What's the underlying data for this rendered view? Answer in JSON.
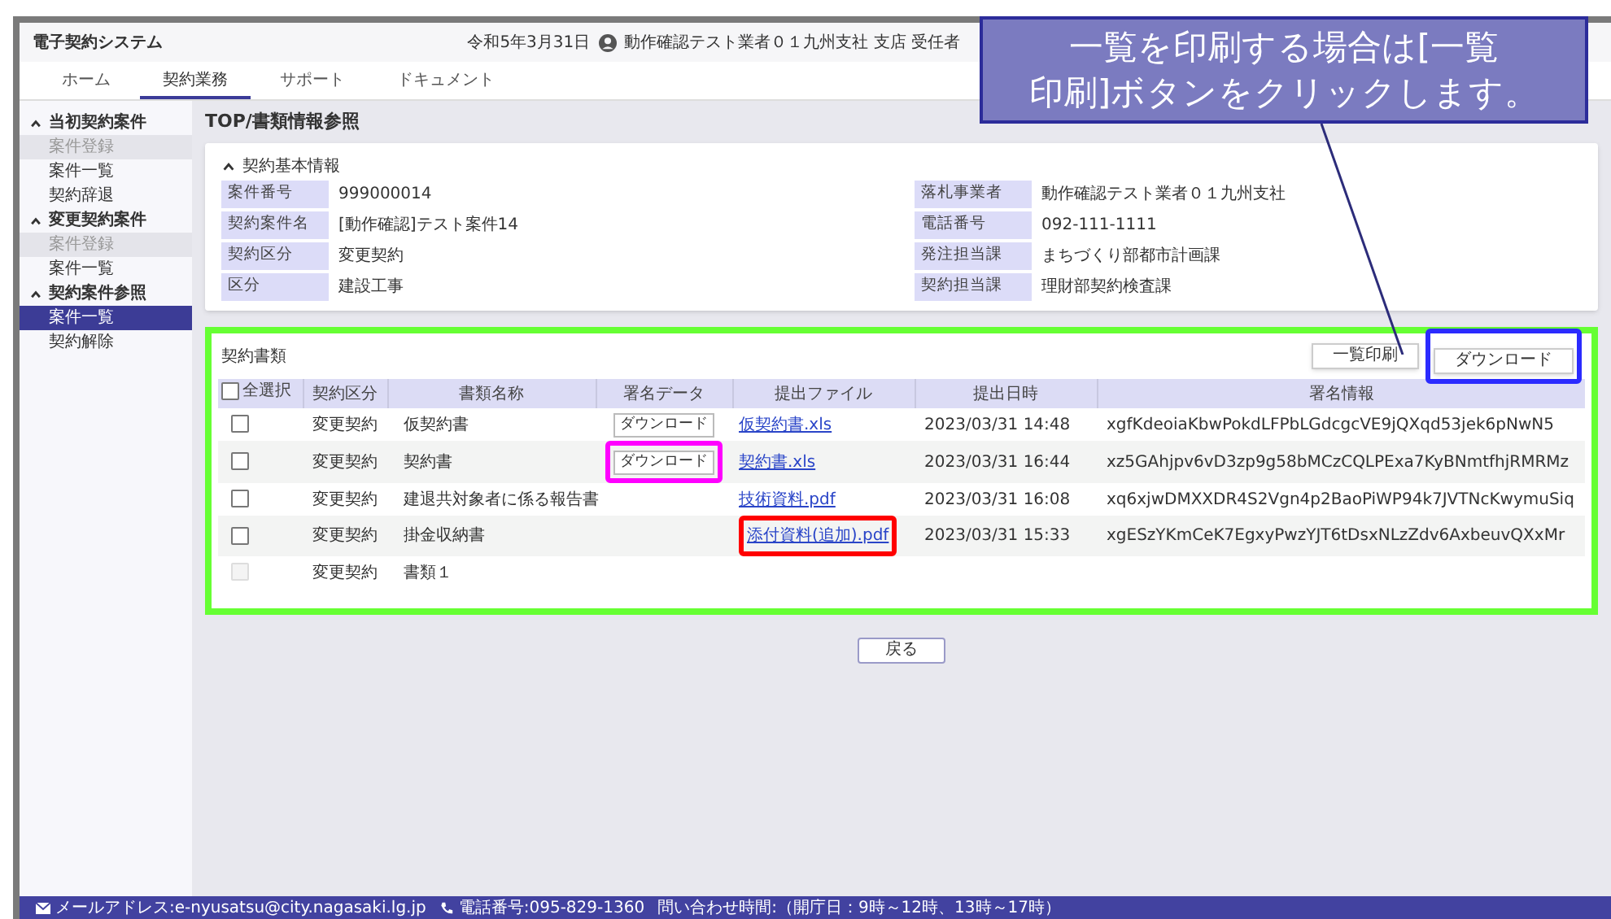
{
  "app_title": "電子契約システム",
  "header_info": {
    "date": "令和5年3月31日",
    "user": "動作確認テスト業者０１九州支社 支店 受任者"
  },
  "callout": {
    "lines": [
      "一覧を印刷する場合は[一覧",
      "印刷]ボタンをクリックします。"
    ]
  },
  "tabs": [
    {
      "label": "ホーム",
      "selected": false
    },
    {
      "label": "契約業務",
      "selected": true
    },
    {
      "label": "サポート",
      "selected": false
    },
    {
      "label": "ドキュメント",
      "selected": false
    }
  ],
  "sidebar": {
    "sections": [
      {
        "label": "当初契約案件",
        "expanded": true,
        "items": [
          {
            "label": "案件登録",
            "disabled": true,
            "selected": false
          },
          {
            "label": "案件一覧",
            "disabled": false,
            "selected": false
          },
          {
            "label": "契約辞退",
            "disabled": false,
            "selected": false
          }
        ]
      },
      {
        "label": "変更契約案件",
        "expanded": true,
        "items": [
          {
            "label": "案件登録",
            "disabled": true,
            "selected": false
          },
          {
            "label": "案件一覧",
            "disabled": false,
            "selected": false
          }
        ]
      },
      {
        "label": "契約案件参照",
        "expanded": true,
        "items": [
          {
            "label": "案件一覧",
            "disabled": false,
            "selected": true
          },
          {
            "label": "契約解除",
            "disabled": false,
            "selected": false
          }
        ]
      }
    ]
  },
  "page_title": "TOP/書類情報参照",
  "basic_info": {
    "title": "契約基本情報",
    "expanded": true,
    "fields": [
      {
        "label": "案件番号",
        "value": "999000014"
      },
      {
        "label": "落札事業者",
        "value": "動作確認テスト業者０１九州支社"
      },
      {
        "label": "契約案件名",
        "value": "[動作確認]テスト案件14"
      },
      {
        "label": "電話番号",
        "value": "092-111-1111"
      },
      {
        "label": "契約区分",
        "value": "変更契約"
      },
      {
        "label": "発注担当課",
        "value": "まちづくり部都市計画課"
      },
      {
        "label": "区分",
        "value": "建設工事"
      },
      {
        "label": "契約担当課",
        "value": "理財部契約検査課"
      }
    ]
  },
  "documents": {
    "title": "契約書類",
    "highlighted": true,
    "buttons": [
      {
        "label": "一覧印刷",
        "highlighted": false
      },
      {
        "label": "ダウンロード",
        "highlighted": true
      }
    ],
    "columns": [
      "全選択",
      "契約区分",
      "書類名称",
      "署名データ",
      "提出ファイル",
      "提出日時",
      "署名情報"
    ],
    "select_all_checked": false,
    "rows": [
      {
        "checked": false,
        "disabled": false,
        "contract_type": "変更契約",
        "name": "仮契約書",
        "signature_button": "ダウンロード",
        "file": "仮契約書.xls",
        "submitted_at": "2023/03/31 14:48",
        "signature": "xgfKdeoiaKbwPokdLFPbLGdcgcVE9jQXqd53jek6pNwN5"
      },
      {
        "checked": false,
        "disabled": false,
        "contract_type": "変更契約",
        "name": "契約書",
        "signature_button": "ダウンロード",
        "signature_highlighted": true,
        "file": "契約書.xls",
        "submitted_at": "2023/03/31 16:44",
        "signature": "xz5GAhjpv6vD3zp9g58bMCzCQLPExa7KyBNmtfhjRMRMz"
      },
      {
        "checked": false,
        "disabled": false,
        "contract_type": "変更契約",
        "name": "建退共対象者に係る報告書",
        "file": "技術資料.pdf",
        "submitted_at": "2023/03/31 16:08",
        "signature": "xq6xjwDMXXDR4S2Vgn4p2BaoPiWP94k7JVTNcKwymuSiq"
      },
      {
        "checked": false,
        "disabled": false,
        "contract_type": "変更契約",
        "name": "掛金収納書",
        "file": "添付資料(追加).pdf",
        "file_highlighted": true,
        "submitted_at": "2023/03/31 15:33",
        "signature": "xgESzYKmCeK7EgxyPwzYJT6tDsxNLzZdv6AxbeuvQXxMr"
      },
      {
        "checked": false,
        "disabled": true,
        "contract_type": "変更契約",
        "name": "書類１"
      }
    ]
  },
  "back_button": "戻る",
  "footer": {
    "email": "メールアドレス:e-nyusatsu@city.nagasaki.lg.jp",
    "phone": "電話番号:095-829-1360",
    "hours": "問い合わせ時間:（開庁日：9時～12時、13時～17時）"
  }
}
